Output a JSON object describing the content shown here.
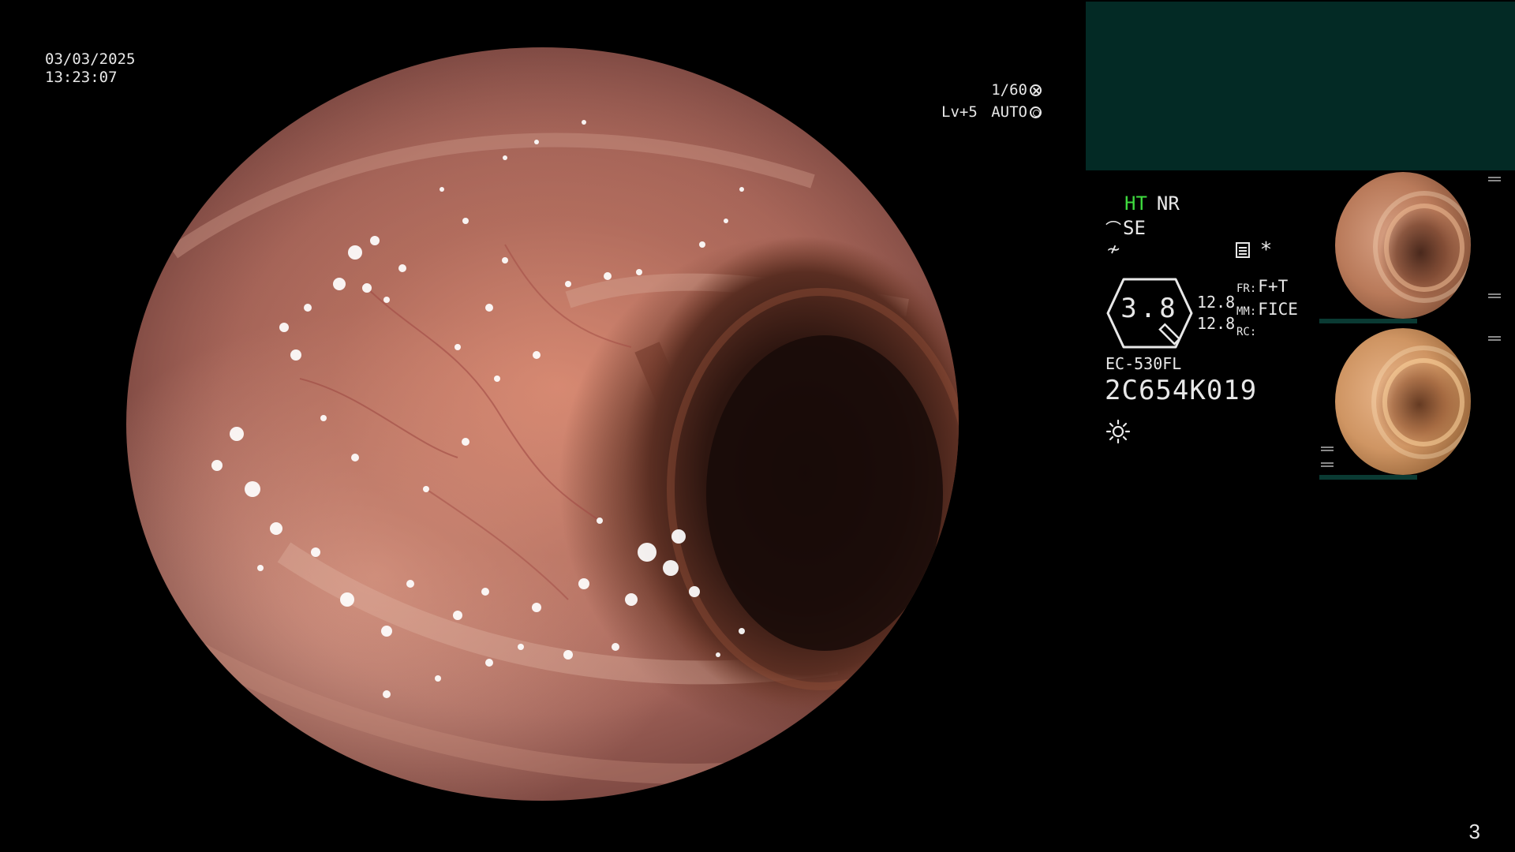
{
  "overlay": {
    "date": "03/03/2025",
    "time": "13:23:07",
    "shutter": "1/60",
    "light_level": "Lv+5",
    "iris_mode": "AUTO"
  },
  "settings": {
    "ht_label": "HT",
    "nr_label": "NR",
    "se_label": "SE",
    "zoom_value": "3.8",
    "values": [
      "12.8",
      "12.8"
    ],
    "fr_key": "FR:",
    "fr_value": "F+T",
    "mm_key": "MM:",
    "mm_value": "FICE",
    "rc_key": "RC:",
    "rc_value": ""
  },
  "scope": {
    "model": "EC-530FL",
    "serial": "2C654K019"
  },
  "footer": {
    "page_number": "3"
  },
  "icons": {
    "shutter": "shutter-icon",
    "iris": "iris-icon",
    "structure": "structure-enhance-icon",
    "wave": "color-wave-icon",
    "memo": "memo-icon",
    "asterisk": "asterisk-icon",
    "light": "light-source-icon"
  },
  "colors": {
    "ht_active": "#3fdc3f",
    "panel_teal": "#032a25",
    "text": "#e8e8e8"
  }
}
